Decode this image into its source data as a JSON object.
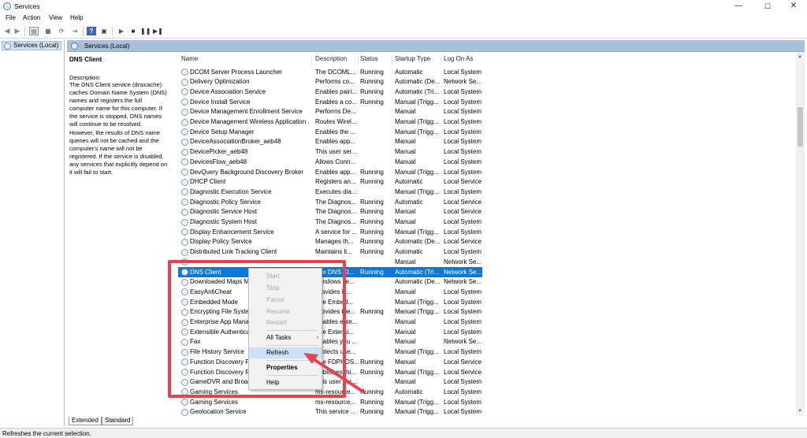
{
  "window": {
    "title": "Services",
    "minimize": "—",
    "maximize": "☐",
    "close": "✕"
  },
  "menu": {
    "items": [
      "File",
      "Action",
      "View",
      "Help"
    ]
  },
  "tree": {
    "root": "Services (Local)"
  },
  "header": {
    "title": "Services (Local)"
  },
  "details": {
    "service_name": "DNS Client",
    "description_label": "Description:",
    "description_lines": [
      "The DNS Client service (dnscache)",
      "caches Domain Name System (DNS)",
      "names and registers the full",
      "computer name for this computer. If",
      "the service is stopped, DNS names",
      "will continue to be resolved.",
      "However, the results of DNS name",
      "queries will not be cached and the",
      "computer's name will not be",
      "registered. If the service is disabled,",
      "any services that explicitly depend on",
      "it will fail to start."
    ]
  },
  "columns": {
    "name": "Name",
    "description": "Description",
    "status": "Status",
    "startup": "Startup Type",
    "logon": "Log On As"
  },
  "rows": [
    {
      "name": "DCOM Server Process Launcher",
      "desc": "The DCOML...",
      "status": "Running",
      "startup": "Automatic",
      "logon": "Local System"
    },
    {
      "name": "Delivery Optimization",
      "desc": "Performs co...",
      "status": "Running",
      "startup": "Automatic (De...",
      "logon": "Network Se..."
    },
    {
      "name": "Device Association Service",
      "desc": "Enables pairi...",
      "status": "Running",
      "startup": "Automatic (Tri...",
      "logon": "Local System"
    },
    {
      "name": "Device Install Service",
      "desc": "Enables a co...",
      "status": "Running",
      "startup": "Manual (Trigg...",
      "logon": "Local System"
    },
    {
      "name": "Device Management Enrollment Service",
      "desc": "Performs De...",
      "status": "",
      "startup": "Manual",
      "logon": "Local System"
    },
    {
      "name": "Device Management Wireless Application ...",
      "desc": "Routes Wirel...",
      "status": "",
      "startup": "Manual (Trigg...",
      "logon": "Local System"
    },
    {
      "name": "Device Setup Manager",
      "desc": "Enables the ...",
      "status": "",
      "startup": "Manual (Trigg...",
      "logon": "Local System"
    },
    {
      "name": "DeviceAssociationBroker_aeb48",
      "desc": "Enables app...",
      "status": "",
      "startup": "Manual",
      "logon": "Local System"
    },
    {
      "name": "DevicePicker_aeb48",
      "desc": "This user ser...",
      "status": "",
      "startup": "Manual",
      "logon": "Local System"
    },
    {
      "name": "DevicesFlow_aeb48",
      "desc": "Allows Conn...",
      "status": "",
      "startup": "Manual",
      "logon": "Local System"
    },
    {
      "name": "DevQuery Background Discovery Broker",
      "desc": "Enables app...",
      "status": "Running",
      "startup": "Manual (Trigg...",
      "logon": "Local System"
    },
    {
      "name": "DHCP Client",
      "desc": "Registers an...",
      "status": "Running",
      "startup": "Automatic",
      "logon": "Local Service"
    },
    {
      "name": "Diagnostic Execution Service",
      "desc": "Executes dia...",
      "status": "",
      "startup": "Manual (Trigg...",
      "logon": "Local System"
    },
    {
      "name": "Diagnostic Policy Service",
      "desc": "The Diagnos...",
      "status": "Running",
      "startup": "Automatic",
      "logon": "Local Service"
    },
    {
      "name": "Diagnostic Service Host",
      "desc": "The Diagnos...",
      "status": "Running",
      "startup": "Manual",
      "logon": "Local Service"
    },
    {
      "name": "Diagnostic System Host",
      "desc": "The Diagnos...",
      "status": "Running",
      "startup": "Manual",
      "logon": "Local System"
    },
    {
      "name": "Display Enhancement Service",
      "desc": "A service for ...",
      "status": "Running",
      "startup": "Manual (Trigg...",
      "logon": "Local System"
    },
    {
      "name": "Display Policy Service",
      "desc": "Manages th...",
      "status": "Running",
      "startup": "Automatic (De...",
      "logon": "Local Service"
    },
    {
      "name": "Distributed Link Tracking Client",
      "desc": "Maintains li...",
      "status": "Running",
      "startup": "Automatic",
      "logon": "Local System"
    },
    {
      "name": "",
      "desc": "",
      "status": "",
      "startup": "Manual",
      "logon": "Network Se..."
    },
    {
      "name": "DNS Client",
      "desc": "The DNS Cl...",
      "status": "Running",
      "startup": "Automatic (Tri...",
      "logon": "Network Se...",
      "selected": true
    },
    {
      "name": "Downloaded Maps M",
      "desc": "Windows se...",
      "status": "",
      "startup": "Automatic (De...",
      "logon": "Network Se..."
    },
    {
      "name": "EasyAntiCheat",
      "desc": "Provides in...",
      "status": "",
      "startup": "Manual",
      "logon": "Local System"
    },
    {
      "name": "Embedded Mode",
      "desc": "The Embed...",
      "status": "",
      "startup": "Manual (Trigg...",
      "logon": "Local System"
    },
    {
      "name": "Encrypting File Syster",
      "desc": "Provides the...",
      "status": "Running",
      "startup": "Manual (Trigg...",
      "logon": "Local System"
    },
    {
      "name": "Enterprise App Mana",
      "desc": "Enables ente...",
      "status": "",
      "startup": "Manual",
      "logon": "Local System"
    },
    {
      "name": "Extensible Authentica",
      "desc": "The Extensi...",
      "status": "",
      "startup": "Manual",
      "logon": "Local System"
    },
    {
      "name": "Fax",
      "desc": "Enables you ...",
      "status": "",
      "startup": "Manual",
      "logon": "Network Se..."
    },
    {
      "name": "File History Service",
      "desc": "Protects use...",
      "status": "",
      "startup": "Manual (Trigg...",
      "logon": "Local System"
    },
    {
      "name": "Function Discovery Pr",
      "desc": "The FDPHOS...",
      "status": "Running",
      "startup": "Manual",
      "logon": "Local Service"
    },
    {
      "name": "Function Discovery Re",
      "desc": "Publishes thi...",
      "status": "Running",
      "startup": "Manual (Trigg...",
      "logon": "Local Service"
    },
    {
      "name": "GameDVR and Broadc",
      "desc": "This user ser...",
      "status": "",
      "startup": "Manual",
      "logon": "Local System"
    },
    {
      "name": "Gaming Services",
      "desc": "ms-resource...",
      "status": "Running",
      "startup": "Automatic",
      "logon": "Local System"
    },
    {
      "name": "Gaming Services",
      "desc": "ms-resource...",
      "status": "Running",
      "startup": "Manual (Trigg...",
      "logon": "Local System"
    },
    {
      "name": "Geolocation Service",
      "desc": "This service ...",
      "status": "Running",
      "startup": "Manual (Trigg...",
      "logon": "Local System"
    }
  ],
  "context_menu": {
    "start": "Start",
    "stop": "Stop",
    "pause": "Pause",
    "resume": "Resume",
    "restart": "Restart",
    "all_tasks": "All Tasks",
    "refresh": "Refresh",
    "properties": "Properties",
    "help": "Help"
  },
  "tabs": {
    "extended": "Extended",
    "standard": "Standard"
  },
  "status_bar": {
    "text": "Refreshes the current selection."
  },
  "colors": {
    "selection": "#0e78d7",
    "highlight_box": "#e8424e",
    "menu_highlight": "#cbe1f6",
    "header": "#a9c0dc"
  }
}
